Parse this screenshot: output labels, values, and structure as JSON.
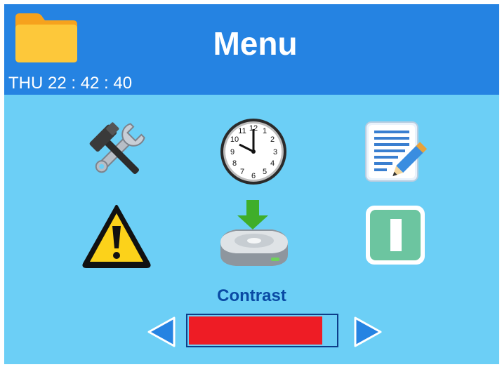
{
  "header": {
    "title": "Menu",
    "datetime": "THU 22 : 42 : 40",
    "folder_icon": "folder-icon"
  },
  "menu": {
    "icons": [
      "tools-icon",
      "clock-icon",
      "notes-icon",
      "warning-icon",
      "download-icon",
      "pause-icon"
    ]
  },
  "contrast": {
    "label": "Contrast",
    "level": 0.91,
    "decrease_icon": "arrow-left-icon",
    "increase_icon": "arrow-right-icon"
  },
  "colors": {
    "header": "#2583e2",
    "background": "#6ccff6",
    "bar_fill": "#ee1c25",
    "label": "#0a4aa4"
  }
}
